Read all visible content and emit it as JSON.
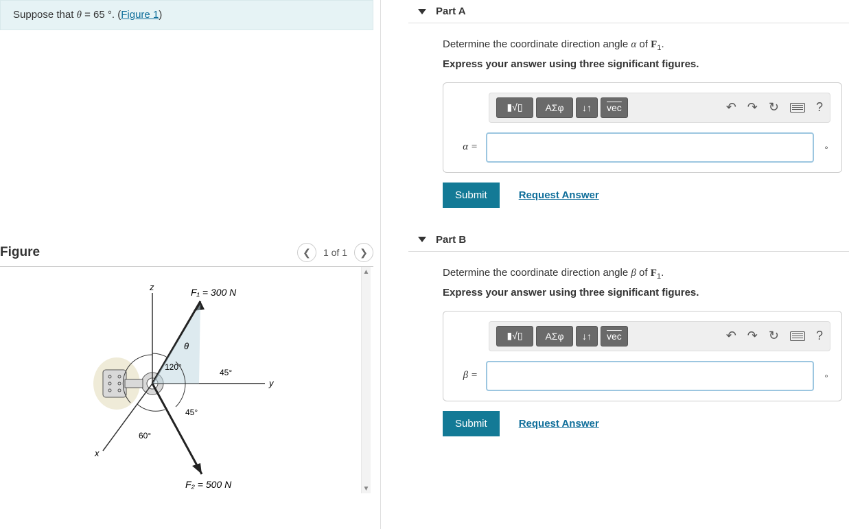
{
  "prompt": {
    "prefix": "Suppose that ",
    "theta_symbol": "θ",
    "equals": " = 65 ",
    "unit": "°",
    "period": ". (",
    "figure_link": "Figure 1",
    "suffix": ")"
  },
  "figure": {
    "title": "Figure",
    "pager_text": "1 of 1",
    "labels": {
      "z": "z",
      "y": "y",
      "x": "x",
      "theta": "θ",
      "a120": "120°",
      "a45u": "45°",
      "a45l": "45°",
      "a60": "60°",
      "F1": "F₁ = 300 N",
      "F2": "F₂ = 500 N"
    }
  },
  "toolbar": {
    "btn_templates": "▮√▯",
    "btn_greek": "ΑΣφ",
    "btn_updown": "↓↑",
    "btn_vec": "vec",
    "undo_hint": "undo",
    "redo_hint": "redo",
    "reset_hint": "reset",
    "keyboard_hint": "keyboard",
    "help": "?"
  },
  "parts": {
    "A": {
      "title": "Part A",
      "question_pre": "Determine the coordinate direction angle ",
      "symbol": "α",
      "question_mid": " of ",
      "vector": "F",
      "vector_sub": "1",
      "question_post": ".",
      "sub_instruction": "Express your answer using three significant figures.",
      "label": "α =",
      "unit": "∘",
      "submit": "Submit",
      "request": "Request Answer"
    },
    "B": {
      "title": "Part B",
      "question_pre": "Determine the coordinate direction angle ",
      "symbol": "β",
      "question_mid": " of ",
      "vector": "F",
      "vector_sub": "1",
      "question_post": ".",
      "sub_instruction": "Express your answer using three significant figures.",
      "label": "β =",
      "unit": "∘",
      "submit": "Submit",
      "request": "Request Answer"
    }
  }
}
